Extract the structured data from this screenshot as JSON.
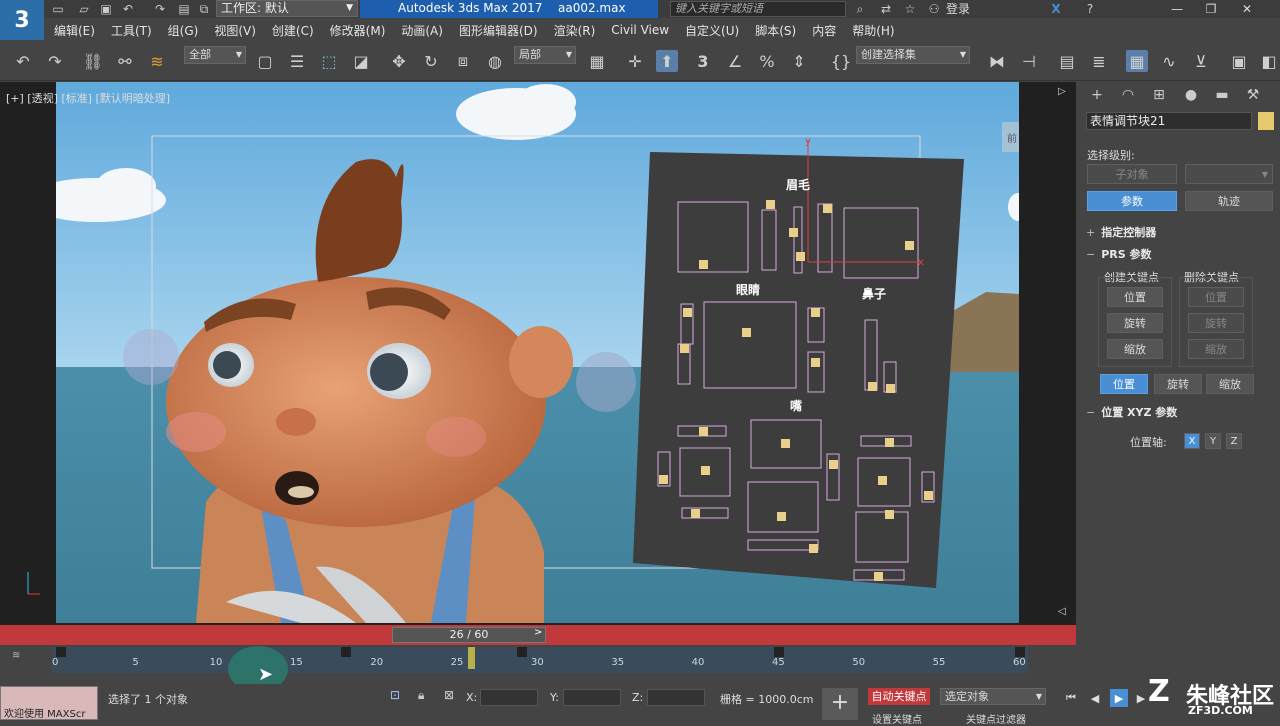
{
  "titlebar": {
    "logo": "3",
    "workspace": "工作区: 默认",
    "app_title": "Autodesk 3ds Max 2017",
    "file_name": "aa002.max",
    "search_placeholder": "键入关键字或短语",
    "login": "登录",
    "icons": [
      "new-file-icon",
      "open-folder-icon",
      "save-icon",
      "undo-icon",
      "redo-icon",
      "project-folder-icon",
      "workspace-icon",
      "binoculars-icon",
      "exchange-icon",
      "star-icon",
      "user-icon",
      "x-icon",
      "help-icon"
    ]
  },
  "menu": [
    "编辑(E)",
    "工具(T)",
    "组(G)",
    "视图(V)",
    "创建(C)",
    "修改器(M)",
    "动画(A)",
    "图形编辑器(D)",
    "渲染(R)",
    "Civil View",
    "自定义(U)",
    "脚本(S)",
    "内容",
    "帮助(H)"
  ],
  "toolbar": {
    "filter_dropdown": "全部",
    "coord_dropdown": "局部",
    "snap_count": "3",
    "selection_set": "创建选择集",
    "icons": [
      "undo-icon",
      "redo-icon",
      "link-icon",
      "unlink-icon",
      "bind-space-warp-icon",
      "select-object-icon",
      "select-by-name-icon",
      "rect-region-icon",
      "window-crossing-icon",
      "move-icon",
      "rotate-icon",
      "scale-icon",
      "select-place-icon",
      "pivot-icon",
      "keyboard-shortcut-icon",
      "snap-icon",
      "angle-snap-icon",
      "percent-snap-icon",
      "spinner-snap-icon",
      "edit-named-selection-icon",
      "mirror-icon",
      "align-icon",
      "layer-manager-icon",
      "scene-explorer-icon",
      "toggle-ribbon-icon",
      "curve-editor-icon",
      "schematic-view-icon",
      "material-editor-icon"
    ]
  },
  "viewport": {
    "label": "[+] [透视] [标准] [默认明暗处理]",
    "panel_labels": {
      "eyebrow": "眉毛",
      "eye": "眼睛",
      "nose": "鼻子",
      "mouth": "嘴"
    },
    "nav_cube_label": "前",
    "axis_y": "y",
    "axis_x": "x"
  },
  "command_panel": {
    "object_name": "表情调节块21",
    "object_color": "#e6c96e",
    "selection_level_label": "选择级别:",
    "sub_object_button": "子对象",
    "params_button": "参数",
    "track_button": "轨迹",
    "rollout_controller": "指定控制器",
    "rollout_prs": "PRS 参数",
    "create_key_label": "创建关键点",
    "delete_key_label": "删除关键点",
    "key_buttons": [
      "位置",
      "旋转",
      "缩放"
    ],
    "tab_buttons": [
      "位置",
      "旋转",
      "缩放"
    ],
    "rollout_xyz": "位置 XYZ 参数",
    "position_axis_label": "位置轴:",
    "axes": [
      "X",
      "Y",
      "Z"
    ],
    "tabs_icons": [
      "create-icon",
      "modify-icon",
      "hierarchy-icon",
      "motion-icon",
      "display-icon",
      "utilities-icon"
    ]
  },
  "timeline": {
    "frame_display": "26 / 60",
    "current_frame": 26,
    "total_frames": 60,
    "ticks": [
      "0",
      "5",
      "10",
      "15",
      "20",
      "25",
      "30",
      "35",
      "40",
      "45",
      "50",
      "55",
      "60"
    ]
  },
  "status": {
    "maxscript_text": "欢迎使用 MAXScr",
    "selection_text": "选择了 1 个对象",
    "x_label": "X:",
    "y_label": "Y:",
    "z_label": "Z:",
    "grid_text": "栅格 = 1000.0cm",
    "auto_key": "自动关键点",
    "selected_object": "选定对象",
    "set_key": "设置关键点",
    "key_filter": "关键点过滤器"
  },
  "watermark": {
    "zh": "朱峰社区",
    "url": "ZF3D.COM"
  }
}
